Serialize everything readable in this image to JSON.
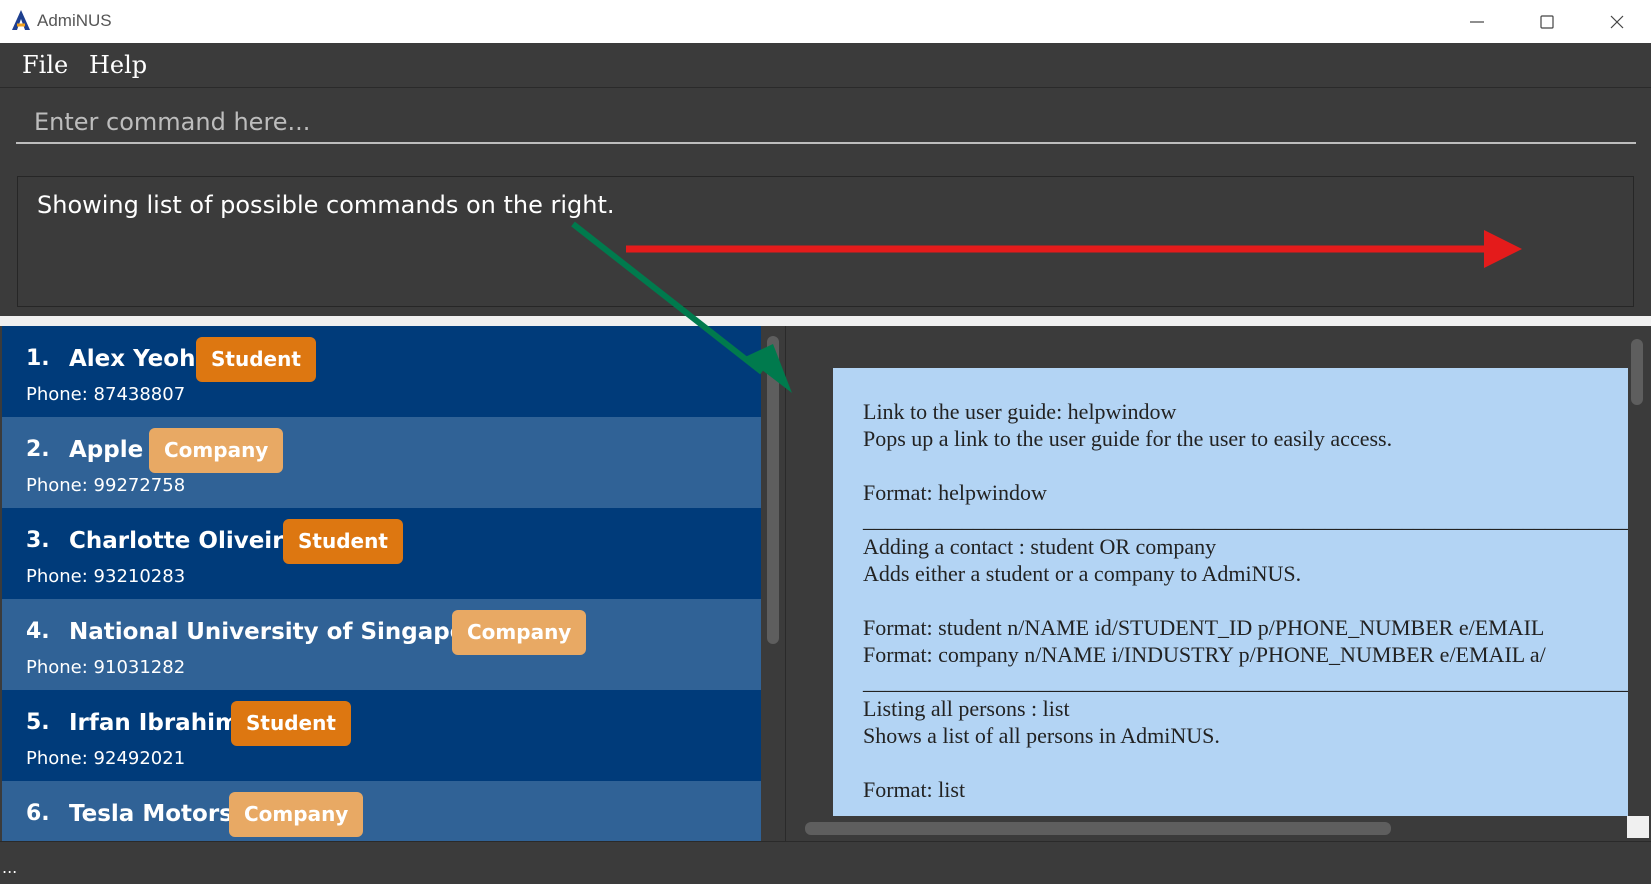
{
  "window": {
    "title": "AdmiNUS"
  },
  "menu": {
    "file": "File",
    "help": "Help"
  },
  "command": {
    "placeholder": "Enter command here..."
  },
  "result": {
    "message": "Showing list of possible commands on the right."
  },
  "contacts": [
    {
      "index": "1.",
      "name": "Alex Yeoh",
      "tag": "Student",
      "phone": "Phone: 87438807"
    },
    {
      "index": "2.",
      "name": "Apple",
      "tag": "Company",
      "phone": "Phone: 99272758"
    },
    {
      "index": "3.",
      "name": "Charlotte Oliveiro",
      "tag": "Student",
      "phone": "Phone: 93210283"
    },
    {
      "index": "4.",
      "name": "National University of Singapore",
      "tag": "Company",
      "phone": "Phone: 91031282"
    },
    {
      "index": "5.",
      "name": "Irfan Ibrahim",
      "tag": "Student",
      "phone": "Phone: 92492021"
    },
    {
      "index": "6.",
      "name": "Tesla Motors",
      "tag": "Company",
      "phone": ""
    }
  ],
  "help": {
    "lines": [
      "Link to the user guide: helpwindow",
      "Pops up a link to the user guide for the user to easily access.",
      "",
      "Format: helpwindow",
      "________________________________________________________________________________",
      "Adding a contact : student OR company",
      "Adds either a student or a company to AdmiNUS.",
      "",
      "Format: student n/NAME id/STUDENT_ID p/PHONE_NUMBER e/EMAIL",
      "Format: company n/NAME i/INDUSTRY p/PHONE_NUMBER e/EMAIL a/",
      "________________________________________________________________________________",
      "Listing all persons : list",
      "Shows a list of all persons in AdmiNUS.",
      "",
      "Format: list"
    ]
  },
  "status": {
    "text": "..."
  },
  "colors": {
    "student_tag": "#dd7711",
    "company_tag": "#e8a964",
    "card_dark": "#003b7a",
    "card_light": "#306296",
    "help_bg": "#b3d4f4",
    "arrow_red": "#e41b1b",
    "arrow_green": "#007a4d"
  },
  "icons": {
    "app": "adminus-logo-icon",
    "minimize": "minimize-icon",
    "maximize": "maximize-icon",
    "close": "close-icon"
  }
}
